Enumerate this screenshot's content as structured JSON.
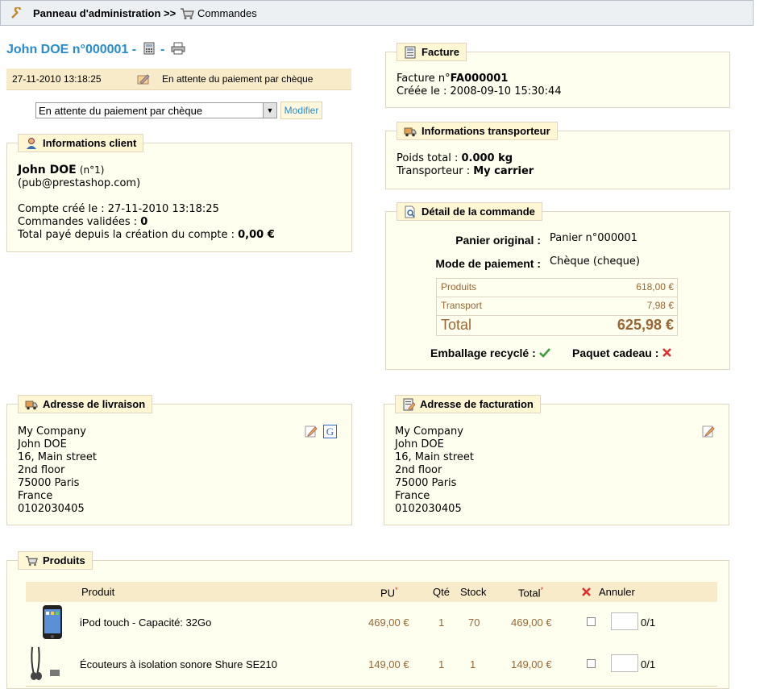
{
  "breadcrumb": {
    "root": "Panneau d'administration >>",
    "current": "Commandes"
  },
  "order": {
    "title": "John DOE n°000001 -",
    "separator": "-"
  },
  "status": {
    "date": "27-11-2010 13:18:25",
    "text": "En attente du paiement par chèque"
  },
  "status_select": {
    "selected": "En attente du paiement par chèque",
    "button": "Modifier"
  },
  "client": {
    "legend": "Informations client",
    "name": "John DOE",
    "number": "(n°1)",
    "email": "(pub@prestashop.com)",
    "created_label": "Compte créé le :",
    "created_value": "27-11-2010 13:18:25",
    "orders_label": "Commandes validées :",
    "orders_value": "0",
    "total_label": "Total payé depuis la création du compte :",
    "total_value": "0,00 €"
  },
  "invoice": {
    "legend": "Facture",
    "number_label": "Facture n°",
    "number_value": "FA000001",
    "created_label": "Créée le :",
    "created_value": "2008-09-10 15:30:44"
  },
  "carrier": {
    "legend": "Informations transporteur",
    "weight_label": "Poids total :",
    "weight_value": "0.000 kg",
    "carrier_label": "Transporteur :",
    "carrier_value": "My carrier"
  },
  "details": {
    "legend": "Détail de la commande",
    "cart_label": "Panier original :",
    "cart_value": "Panier n°000001",
    "payment_label": "Mode de paiement :",
    "payment_value": "Chèque (cheque)",
    "products_label": "Produits",
    "products_value": "618,00 €",
    "shipping_label": "Transport",
    "shipping_value": "7,98 €",
    "total_label": "Total",
    "total_value": "625,98 €",
    "recycled_label": "Emballage recyclé :",
    "gift_label": "Paquet cadeau :"
  },
  "delivery": {
    "legend": "Adresse de livraison",
    "lines": [
      "My Company",
      "John DOE",
      "16, Main street",
      "2nd floor",
      "75000 Paris",
      "France",
      "0102030405"
    ]
  },
  "billing": {
    "legend": "Adresse de facturation",
    "lines": [
      "My Company",
      "John DOE",
      "16, Main street",
      "2nd floor",
      "75000 Paris",
      "France",
      "0102030405"
    ]
  },
  "products": {
    "legend": "Produits",
    "headers": {
      "product": "Produit",
      "unit": "PU",
      "qty": "Qté",
      "stock": "Stock",
      "total": "Total",
      "cancel": "Annuler",
      "required_mark": "*"
    },
    "rows": [
      {
        "name": "iPod touch - Capacité: 32Go",
        "unit": "469,00 €",
        "qty": "1",
        "stock": "70",
        "total": "469,00 €",
        "cancel": "0/1"
      },
      {
        "name": "Écouteurs à isolation sonore Shure SE210",
        "unit": "149,00 €",
        "qty": "1",
        "stock": "1",
        "total": "149,00 €",
        "cancel": "0/1"
      }
    ]
  },
  "colors": {
    "link": "#268ccd",
    "accent": "#996633",
    "panel": "#fffff0",
    "legend": "#fff6d3"
  }
}
